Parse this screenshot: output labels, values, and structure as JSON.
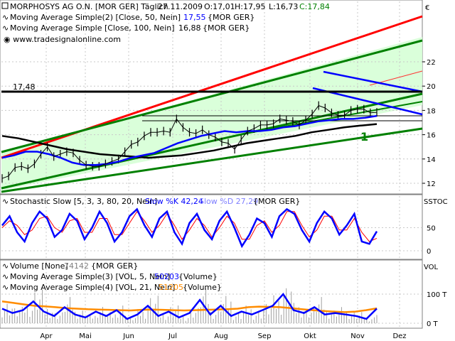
{
  "header": {
    "symbol": "MORPHOSYS AG O.N. [MOR GER]  Täglich",
    "date": "27.11.2009",
    "open": "O:17,01",
    "high": "H:17,95",
    "low": "L:16,73",
    "close": "C:17,84",
    "ma50_label": "Moving Average Simple(2) [Close, 50, Nein]",
    "ma50_value": "17,55",
    "ma50_ref": "{MOR GER}",
    "ma100_label": "Moving Average Simple [Close, 100, Nein]",
    "ma100_value": "16,88",
    "ma100_ref": "{MOR GER}",
    "website": "www.tradesignalonline.com",
    "currency": "€",
    "hline_label": "17,48",
    "annotation": "1"
  },
  "stoch_header": {
    "label": "Stochastic Slow [5, 3, 3, 80, 20, Nein]",
    "k": "Slow %K 42,24",
    "d": "Slow %D 27,29",
    "ref": "{MOR GER}",
    "axis": "SSTOC"
  },
  "volume_header": {
    "label": "Volume [None]",
    "value": "74142",
    "ref": "{MOR GER}",
    "ma5_label": "Moving Average Simple(3) [VOL, 5, Nein]",
    "ma5_value": "50203",
    "ma5_ref": "{Volume}",
    "ma21_label": "Moving Average Simple(4) [VOL, 21, Nein]",
    "ma21_value": "51205",
    "ma21_ref": "{Volume}",
    "axis": "VOL"
  },
  "colors": {
    "price": "#000000",
    "ma50": "#0000ff",
    "ma100": "#000000",
    "channel_green": "#008000",
    "channel_red": "#ff0000",
    "fill_green": "#ccffcc",
    "stoch_k": "#0000ff",
    "stoch_d": "#ff0000",
    "vol_ma5": "#0000ff",
    "vol_ma21": "#ff8c00"
  },
  "chart_data": [
    {
      "type": "line",
      "title": "MORPHOSYS AG O.N. [MOR GER]  Täglich",
      "ylim": [
        11.3,
        24.5
      ],
      "yticks": [
        "12",
        "14",
        "16",
        "18",
        "20",
        "22"
      ],
      "x_months": [
        "Apr",
        "Mai",
        "Jun",
        "Jul",
        "Aug",
        "Sep",
        "Okt",
        "Nov",
        "Dez"
      ],
      "close": [
        12.4,
        12.6,
        13.3,
        13.4,
        13.2,
        13.6,
        14.4,
        15.0,
        14.2,
        14.4,
        14.6,
        14.5,
        13.9,
        13.5,
        13.4,
        13.4,
        13.6,
        13.8,
        14.0,
        14.6,
        15.2,
        15.4,
        15.9,
        16.2,
        16.2,
        16.3,
        16.2,
        17.3,
        16.6,
        16.2,
        16.1,
        16.4,
        16.0,
        15.8,
        15.4,
        15.3,
        14.8,
        15.6,
        16.3,
        16.5,
        16.8,
        16.8,
        16.9,
        17.3,
        17.2,
        17.1,
        16.8,
        17.2,
        17.7,
        18.4,
        18.2,
        17.8,
        17.6,
        17.6,
        18.0,
        18.1,
        18.1,
        17.8,
        17.84
      ],
      "series": [
        {
          "name": "Moving Average Simple(2) [Close, 50, Nein]",
          "values": [
            14.1,
            14.3,
            14.6,
            14.6,
            14.4,
            14.1,
            13.7,
            13.5,
            13.5,
            13.6,
            13.8,
            14.1,
            14.3,
            14.5,
            14.9,
            15.3,
            15.6,
            15.9,
            16.1,
            16.3,
            16.2,
            16.3,
            16.3,
            16.4,
            16.6,
            16.7,
            16.9,
            17.1,
            17.2,
            17.3,
            17.3,
            17.4,
            17.55
          ]
        },
        {
          "name": "Moving Average Simple [Close, 100, Nein]",
          "values": [
            15.9,
            15.7,
            15.4,
            15.1,
            14.8,
            14.6,
            14.4,
            14.3,
            14.2,
            14.1,
            14.2,
            14.3,
            14.5,
            14.7,
            15.0,
            15.3,
            15.5,
            15.7,
            15.9,
            16.2,
            16.4,
            16.6,
            16.75,
            16.88
          ]
        }
      ],
      "hline": 17.48
    },
    {
      "type": "line",
      "title": "Stochastic Slow [5, 3, 3, 80, 20, Nein]",
      "ylim": [
        -10,
        110
      ],
      "yticks": [
        "0",
        "50"
      ],
      "series": [
        {
          "name": "Slow %K",
          "values": [
            55,
            75,
            40,
            20,
            60,
            85,
            70,
            30,
            45,
            80,
            65,
            25,
            50,
            85,
            60,
            20,
            40,
            75,
            90,
            55,
            30,
            70,
            85,
            40,
            15,
            60,
            80,
            45,
            25,
            65,
            85,
            50,
            10,
            35,
            70,
            60,
            30,
            75,
            90,
            80,
            45,
            20,
            60,
            85,
            70,
            35,
            55,
            80,
            20,
            15,
            42
          ]
        },
        {
          "name": "Slow %D",
          "values": [
            50,
            65,
            55,
            35,
            45,
            70,
            75,
            50,
            40,
            65,
            70,
            40,
            40,
            70,
            70,
            35,
            35,
            60,
            85,
            65,
            40,
            55,
            80,
            55,
            25,
            45,
            70,
            55,
            30,
            50,
            75,
            60,
            25,
            25,
            55,
            65,
            40,
            55,
            85,
            85,
            55,
            30,
            45,
            75,
            75,
            45,
            45,
            70,
            40,
            20,
            27
          ]
        }
      ]
    },
    {
      "type": "bar",
      "title": "Volume [None]",
      "yticks": [
        "0 T",
        "100 T"
      ],
      "series": [
        {
          "name": "Moving Average Simple(3) [VOL, 5, Nein]",
          "values": [
            50,
            35,
            45,
            75,
            40,
            25,
            55,
            30,
            20,
            40,
            25,
            45,
            15,
            30,
            60,
            25,
            40,
            20,
            35,
            80,
            30,
            60,
            25,
            40,
            30,
            45,
            60,
            100,
            45,
            35,
            55,
            30,
            35,
            30,
            25,
            15,
            50.2
          ]
        },
        {
          "name": "Moving Average Simple(4) [VOL, 21, Nein]",
          "values": [
            75,
            70,
            65,
            60,
            58,
            55,
            52,
            50,
            48,
            47,
            46,
            45,
            44,
            46,
            47,
            46,
            45,
            44,
            45,
            46,
            47,
            48,
            50,
            55,
            57,
            56,
            55,
            52,
            48,
            45,
            42,
            40,
            38,
            40,
            45,
            51.2
          ]
        }
      ]
    }
  ]
}
